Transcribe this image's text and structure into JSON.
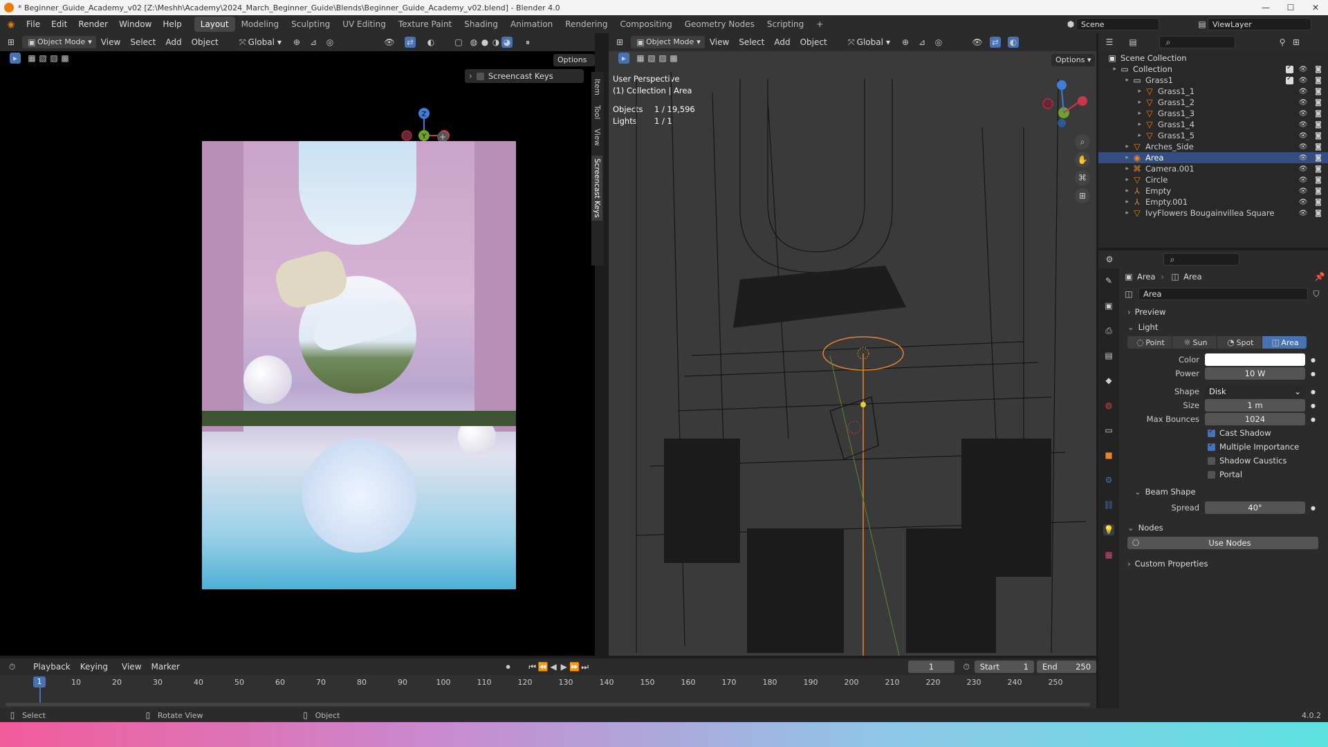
{
  "window": {
    "title": "* Beginner_Guide_Academy_v02 [Z:\\Meshh\\Academy\\2024_March_Beginner_Guide\\Blends\\Beginner_Guide_Academy_v02.blend] - Blender 4.0",
    "min": "—",
    "max": "☐",
    "close": "✕"
  },
  "menu": [
    "File",
    "Edit",
    "Render",
    "Window",
    "Help"
  ],
  "workspaces": [
    "Layout",
    "Modeling",
    "Sculpting",
    "UV Editing",
    "Texture Paint",
    "Shading",
    "Animation",
    "Rendering",
    "Compositing",
    "Geometry Nodes",
    "Scripting"
  ],
  "workspace_add": "+",
  "scene": {
    "label": "Scene",
    "view_layer": "ViewLayer"
  },
  "left_view": {
    "mode": "Object Mode",
    "menus": [
      "View",
      "Select",
      "Add",
      "Object"
    ],
    "orientation": "Global",
    "options": "Options",
    "screencast_panel": "Screencast Keys",
    "side_tabs": [
      "Item",
      "Tool",
      "View",
      "Screencast Keys"
    ],
    "gizmo": {
      "z": "Z",
      "y": "Y",
      "x": "X"
    }
  },
  "right_view": {
    "mode": "Object Mode",
    "menus": [
      "View",
      "Select",
      "Add",
      "Object"
    ],
    "orientation": "Global",
    "options": "Options",
    "perspective": "User Perspective",
    "collection_info": "(1) Collection | Area",
    "objects_label": "Objects",
    "objects_value": "1 / 19,596",
    "lights_label": "Lights",
    "lights_value": "1 / 1"
  },
  "outliner": {
    "rows": [
      {
        "name": "Scene Collection",
        "indent": 0,
        "icon": "scene-collection-icon"
      },
      {
        "name": "Collection",
        "indent": 1,
        "icon": "collection-icon",
        "check": true
      },
      {
        "name": "Grass1",
        "indent": 2,
        "icon": "collection-icon",
        "check": true
      },
      {
        "name": "Grass1_1",
        "indent": 3,
        "icon": "mesh-icon"
      },
      {
        "name": "Grass1_2",
        "indent": 3,
        "icon": "mesh-icon"
      },
      {
        "name": "Grass1_3",
        "indent": 3,
        "icon": "mesh-icon"
      },
      {
        "name": "Grass1_4",
        "indent": 3,
        "icon": "mesh-icon"
      },
      {
        "name": "Grass1_5",
        "indent": 3,
        "icon": "mesh-icon"
      },
      {
        "name": "Arches_Side",
        "indent": 2,
        "icon": "mesh-icon"
      },
      {
        "name": "Area",
        "indent": 2,
        "icon": "light-icon",
        "selected": true
      },
      {
        "name": "Camera.001",
        "indent": 2,
        "icon": "camera-icon"
      },
      {
        "name": "Circle",
        "indent": 2,
        "icon": "mesh-icon"
      },
      {
        "name": "Empty",
        "indent": 2,
        "icon": "empty-icon"
      },
      {
        "name": "Empty.001",
        "indent": 2,
        "icon": "empty-icon"
      },
      {
        "name": "IvyFlowers Bougainvillea Square",
        "indent": 2,
        "icon": "mesh-icon"
      }
    ]
  },
  "properties": {
    "breadcrumb": [
      "Area",
      "Area"
    ],
    "datablock": "Area",
    "sections": {
      "preview": "Preview",
      "light": "Light",
      "beam": "Beam Shape",
      "nodes": "Nodes",
      "custom": "Custom Properties"
    },
    "light_types": [
      "Point",
      "Sun",
      "Spot",
      "Area"
    ],
    "color_label": "Color",
    "power_label": "Power",
    "power": "10 W",
    "shape_label": "Shape",
    "shape": "Disk",
    "size_label": "Size",
    "size": "1 m",
    "bounces_label": "Max Bounces",
    "bounces": "1024",
    "cast_shadow": "Cast Shadow",
    "multiple_importance": "Multiple Importance",
    "shadow_caustics": "Shadow Caustics",
    "portal": "Portal",
    "spread_label": "Spread",
    "spread": "40°",
    "use_nodes": "Use Nodes"
  },
  "timeline": {
    "menus": [
      "Playback",
      "Keying",
      "View",
      "Marker"
    ],
    "current_frame": "1",
    "start_label": "Start",
    "start": "1",
    "end_label": "End",
    "end": "250",
    "current_marker": "1",
    "ticks": [
      "10",
      "20",
      "30",
      "40",
      "50",
      "60",
      "70",
      "80",
      "90",
      "100",
      "110",
      "120",
      "130",
      "140",
      "150",
      "160",
      "170",
      "180",
      "190",
      "200",
      "210",
      "220",
      "230",
      "240",
      "250"
    ]
  },
  "status": {
    "select": "Select",
    "rotate": "Rotate View",
    "object": "Object",
    "version": "4.0.2"
  },
  "colors": {
    "accent": "#4772b3",
    "selected_row": "#334d80",
    "light_orange": "#e8852b"
  }
}
